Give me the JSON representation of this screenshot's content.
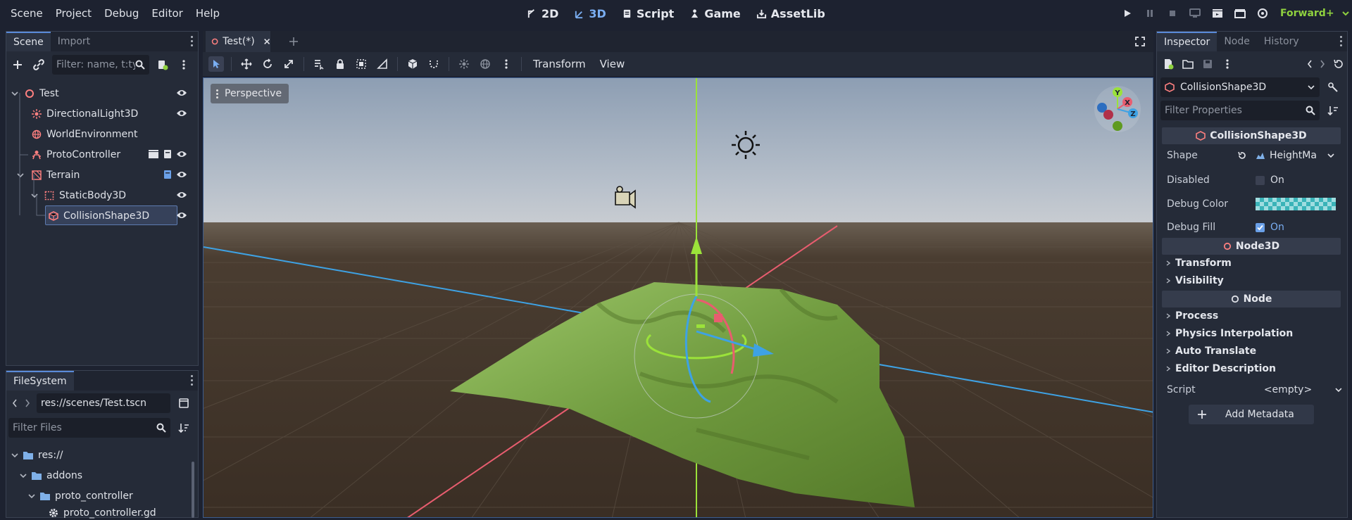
{
  "menu": [
    "Scene",
    "Project",
    "Debug",
    "Editor",
    "Help"
  ],
  "main_screens": [
    {
      "label": "2D",
      "icon": "2d-icon",
      "active": false
    },
    {
      "label": "3D",
      "icon": "3d-icon",
      "active": true
    },
    {
      "label": "Script",
      "icon": "script-icon",
      "active": false
    },
    {
      "label": "Game",
      "icon": "game-icon",
      "active": false
    },
    {
      "label": "AssetLib",
      "icon": "assetlib-icon",
      "active": false
    }
  ],
  "renderer": "Forward+",
  "scene_dock": {
    "tabs": [
      "Scene",
      "Import"
    ],
    "filter_placeholder": "Filter: name, t:ty",
    "nodes": [
      {
        "label": "Test",
        "icon": "node3d-icon",
        "depth": 0
      },
      {
        "label": "DirectionalLight3D",
        "icon": "light-icon",
        "depth": 1
      },
      {
        "label": "WorldEnvironment",
        "icon": "globe-icon",
        "depth": 1
      },
      {
        "label": "ProtoController",
        "icon": "character-icon",
        "depth": 1
      },
      {
        "label": "Terrain",
        "icon": "terrain-icon",
        "depth": 1
      },
      {
        "label": "StaticBody3D",
        "icon": "staticbody-icon",
        "depth": 2
      },
      {
        "label": "CollisionShape3D",
        "icon": "collision-icon",
        "depth": 3
      }
    ]
  },
  "filesystem_dock": {
    "tab": "FileSystem",
    "path": "res://scenes/Test.tscn",
    "filter_placeholder": "Filter Files",
    "items": [
      {
        "label": "res://",
        "depth": 0
      },
      {
        "label": "addons",
        "depth": 1
      },
      {
        "label": "proto_controller",
        "depth": 2
      },
      {
        "label": "proto_controller.gd",
        "depth": 3
      }
    ]
  },
  "editor": {
    "scene_tab": "Test(*)",
    "view_menu": [
      "Transform",
      "View"
    ],
    "viewport_label": "Perspective",
    "gizmo_axes": [
      "Y",
      "X",
      "Z"
    ]
  },
  "inspector": {
    "tabs": [
      "Inspector",
      "Node",
      "History"
    ],
    "object_name": "CollisionShape3D",
    "filter_placeholder": "Filter Properties",
    "sections": {
      "collision": "CollisionShape3D",
      "node3d": "Node3D",
      "node": "Node"
    },
    "props": {
      "shape_label": "Shape",
      "shape_value": "HeightMa",
      "disabled_label": "Disabled",
      "disabled_value": "On",
      "debug_color_label": "Debug Color",
      "debug_fill_label": "Debug Fill",
      "debug_fill_value": "On",
      "script_label": "Script",
      "script_value": "<empty>"
    },
    "groups_node3d": [
      "Transform",
      "Visibility"
    ],
    "groups_node": [
      "Process",
      "Physics Interpolation",
      "Auto Translate",
      "Editor Description"
    ],
    "add_metadata": "Add Metadata"
  }
}
